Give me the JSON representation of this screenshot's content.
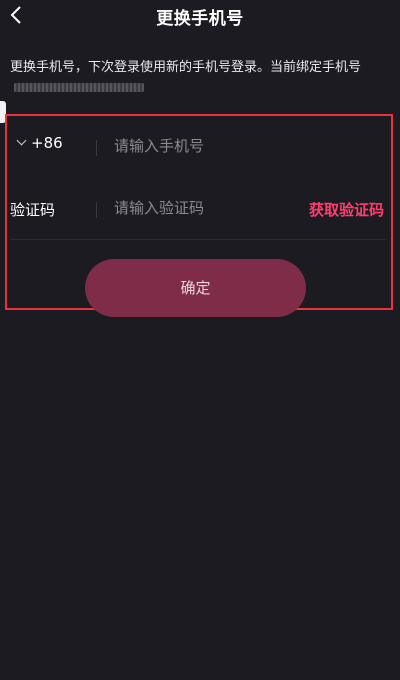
{
  "header": {
    "title": "更换手机号"
  },
  "description": {
    "text": "更换手机号，下次登录使用新的手机号登录。当前绑定手机号 "
  },
  "phone_row": {
    "country_code": "+86",
    "placeholder": "请输入手机号",
    "value": ""
  },
  "code_row": {
    "label": "验证码",
    "placeholder": "请输入验证码",
    "value": "",
    "get_code_label": "获取验证码"
  },
  "confirm": {
    "label": "确定"
  },
  "colors": {
    "background": "#1c1b22",
    "accent": "#ff3f6e",
    "button": "#7e2c48",
    "highlight": "#e8323c"
  },
  "icons": {
    "back": "chevron-left-icon",
    "dropdown": "chevron-down-icon"
  }
}
